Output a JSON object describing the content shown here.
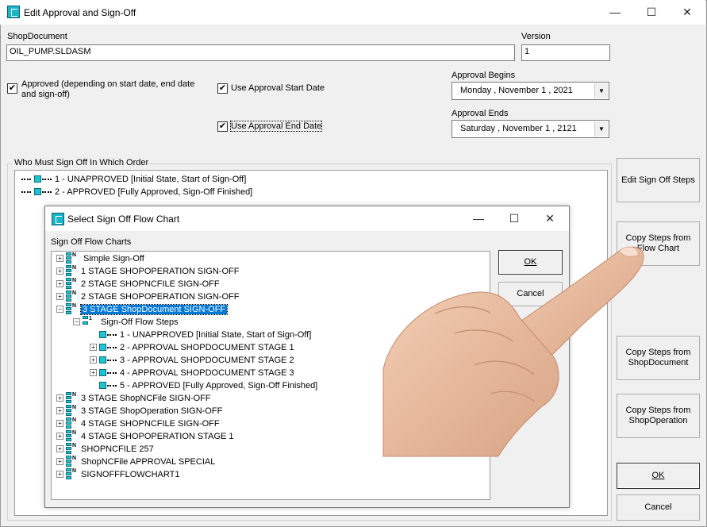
{
  "window": {
    "title": "Edit Approval and Sign-Off",
    "min_glyph": "—",
    "max_glyph": "☐",
    "close_glyph": "✕"
  },
  "form": {
    "shop_document_label": "ShopDocument",
    "shop_document_value": "OIL_PUMP.SLDASM",
    "version_label": "Version",
    "version_value": "1",
    "approved_label_1": "Approved (depending on start date, end date",
    "approved_label_2": "and sign-off)",
    "approved_checked": true,
    "use_start_label": "Use Approval Start Date",
    "use_start_checked": true,
    "use_end_label": "Use Approval End Date",
    "use_end_checked": true,
    "begins_label": "Approval Begins",
    "begins_value": "Monday    , November  1 , 2021",
    "ends_label": "Approval Ends",
    "ends_value": "Saturday   , November  1 , 2121"
  },
  "group": {
    "label": "Who Must Sign Off In Which Order",
    "items": [
      "1 - UNAPPROVED [Initial State, Start of Sign-Off]",
      "2 - APPROVED [Fully Approved, Sign-Off Finished]"
    ]
  },
  "side_buttons": {
    "edit_steps": "Edit Sign Off Steps",
    "copy_flow_1": "Copy Steps from",
    "copy_flow_2": "Flow Chart",
    "copy_doc_1": "Copy Steps from",
    "copy_doc_2": "ShopDocument",
    "copy_op_1": "Copy Steps from",
    "copy_op_2": "ShopOperation",
    "ok": "OK",
    "cancel": "Cancel"
  },
  "dialog": {
    "title": "Select Sign Off Flow Chart",
    "list_label": "Sign Off Flow Charts",
    "ok": "OK",
    "cancel": "Cancel",
    "stack_label": "N",
    "tree": [
      "Simple Sign-Off",
      "1 STAGE SHOPOPERATION SIGN-OFF",
      "2 STAGE SHOPNCFILE SIGN-OFF",
      "2 STAGE SHOPOPERATION SIGN-OFF",
      "3 STAGE ShopDocument SIGN-OFF",
      "Sign-Off Flow Steps",
      "1 - UNAPPROVED [Initial State, Start of Sign-Off]",
      "2 - APPROVAL SHOPDOCUMENT STAGE 1",
      "3 - APPROVAL SHOPDOCUMENT STAGE 2",
      "4 - APPROVAL SHOPDOCUMENT STAGE 3",
      "5 - APPROVED [Fully Approved, Sign-Off Finished]",
      "3 STAGE ShopNCFile SIGN-OFF",
      "3 STAGE ShopOperation SIGN-OFF",
      "4 STAGE SHOPNCFILE SIGN-OFF",
      "4 STAGE SHOPOPERATION STAGE 1",
      "SHOPNCFILE 257",
      "ShopNCFile APPROVAL SPECIAL",
      "SIGNOFFFLOWCHART1"
    ]
  }
}
